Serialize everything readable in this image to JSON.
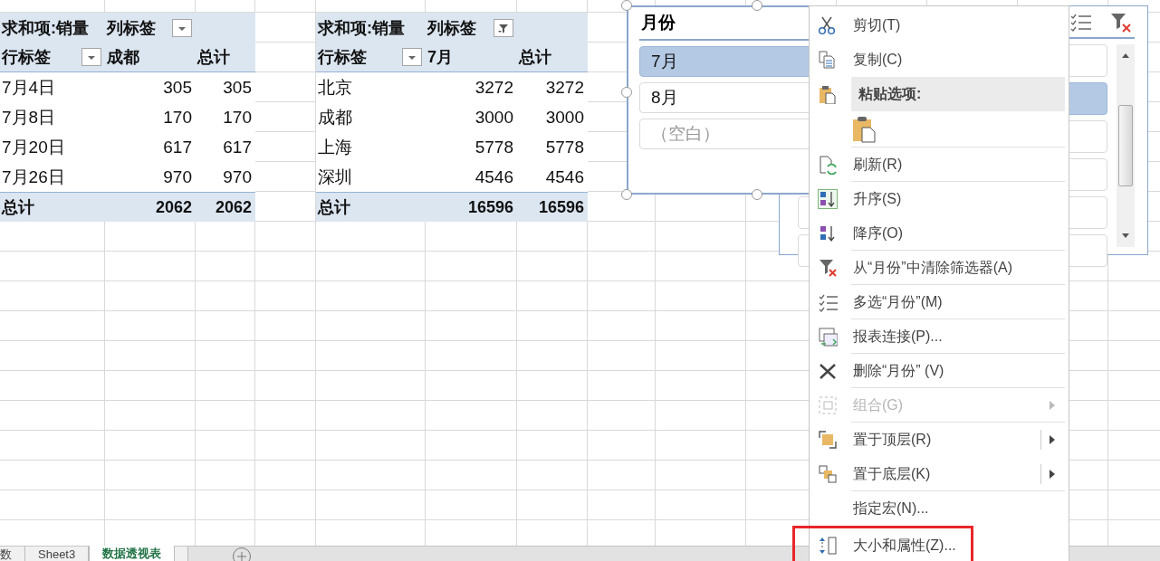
{
  "pivot_tables": [
    {
      "value_label": "求和项:销量",
      "column_label": "列标签",
      "column_filter_active": false,
      "row_label": "行标签",
      "column_headers": [
        "成都",
        "总计"
      ],
      "rows": [
        {
          "label": "7月4日",
          "values": [
            "305",
            "305"
          ]
        },
        {
          "label": "7月8日",
          "values": [
            "170",
            "170"
          ]
        },
        {
          "label": "7月20日",
          "values": [
            "617",
            "617"
          ]
        },
        {
          "label": "7月26日",
          "values": [
            "970",
            "970"
          ]
        }
      ],
      "total": {
        "label": "总计",
        "values": [
          "2062",
          "2062"
        ]
      }
    },
    {
      "value_label": "求和项:销量",
      "column_label": "列标签",
      "column_filter_active": true,
      "row_label": "行标签",
      "column_headers": [
        "7月",
        "总计"
      ],
      "rows": [
        {
          "label": "北京",
          "values": [
            "3272",
            "3272"
          ]
        },
        {
          "label": "成都",
          "values": [
            "3000",
            "3000"
          ]
        },
        {
          "label": "上海",
          "values": [
            "5778",
            "5778"
          ]
        },
        {
          "label": "深圳",
          "values": [
            "4546",
            "4546"
          ]
        }
      ],
      "total": {
        "label": "总计",
        "values": [
          "16596",
          "16596"
        ]
      }
    }
  ],
  "back_slicer": {
    "items": [
      {
        "selected": false
      },
      {
        "selected": true
      },
      {
        "selected": false
      },
      {
        "selected": false
      },
      {
        "selected": false
      },
      {
        "selected": false
      }
    ]
  },
  "slicer": {
    "title": "月份",
    "items": [
      {
        "label": "7月",
        "selected": true,
        "has_data": true
      },
      {
        "label": "8月",
        "selected": false,
        "has_data": true
      },
      {
        "label": "（空白）",
        "selected": false,
        "has_data": false
      }
    ]
  },
  "context_menu": {
    "items": [
      {
        "kind": "command",
        "label": "剪切(T)",
        "disabled": false,
        "separator": false
      },
      {
        "kind": "command",
        "label": "复制(C)",
        "disabled": false,
        "separator": false
      },
      {
        "kind": "section",
        "label": "粘贴选项:"
      },
      {
        "kind": "paste-options",
        "separator": true
      },
      {
        "kind": "command",
        "label": "刷新(R)",
        "disabled": false,
        "separator": true
      },
      {
        "kind": "command",
        "label": "升序(S)",
        "disabled": false,
        "separator": false
      },
      {
        "kind": "command",
        "label": "降序(O)",
        "disabled": false,
        "separator": true
      },
      {
        "kind": "command",
        "label": "从“月份”中清除筛选器(A)",
        "disabled": false,
        "separator": true
      },
      {
        "kind": "command",
        "label": "多选“月份”(M)",
        "disabled": false,
        "separator": true
      },
      {
        "kind": "command",
        "label": "报表连接(P)...",
        "disabled": false,
        "separator": true
      },
      {
        "kind": "command",
        "label": "删除“月份” (V)",
        "disabled": false,
        "separator": true
      },
      {
        "kind": "command",
        "label": "组合(G)",
        "disabled": true,
        "submenu": true,
        "split": false,
        "separator": true
      },
      {
        "kind": "command",
        "label": "置于顶层(R)",
        "disabled": false,
        "submenu": true,
        "split": true,
        "separator": false
      },
      {
        "kind": "command",
        "label": "置于底层(K)",
        "disabled": false,
        "submenu": true,
        "split": true,
        "separator": true
      },
      {
        "kind": "command",
        "label": "指定宏(N)...",
        "disabled": false,
        "separator": false
      },
      {
        "kind": "command",
        "label": "大小和属性(Z)...",
        "disabled": false,
        "separator": false,
        "highlighted": true
      }
    ]
  },
  "sheet_tabs": [
    {
      "label": "数",
      "selected": false
    },
    {
      "label": "Sheet3",
      "selected": false
    },
    {
      "label": "数据透视表",
      "selected": true
    }
  ]
}
